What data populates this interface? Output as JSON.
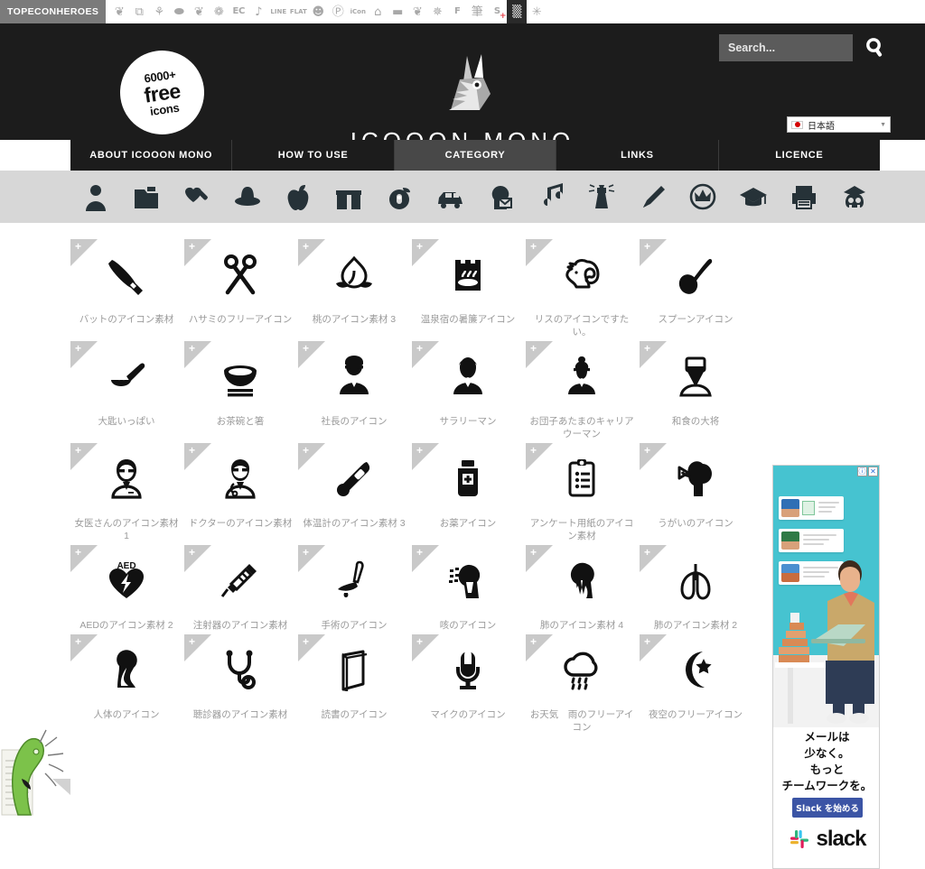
{
  "topbar": {
    "brand": "TOPECONHEROES",
    "icons": [
      {
        "name": "sheep-icon",
        "glyph": "❦",
        "kind": "glyph"
      },
      {
        "name": "copy-icon",
        "glyph": "⧉",
        "kind": "glyph"
      },
      {
        "name": "person-cheer-icon",
        "glyph": "⚘",
        "kind": "glyph"
      },
      {
        "name": "speech-bubble-icon",
        "glyph": "⬬",
        "kind": "glyph"
      },
      {
        "name": "leaf-icon",
        "glyph": "❦",
        "kind": "glyph"
      },
      {
        "name": "flower-icon",
        "glyph": "❁",
        "kind": "glyph"
      },
      {
        "name": "ec-icon",
        "glyph": "EC",
        "kind": "label"
      },
      {
        "name": "music-note-icon",
        "glyph": "♪",
        "kind": "glyph"
      },
      {
        "name": "line-icon",
        "glyph": "LINE",
        "kind": "two"
      },
      {
        "name": "flat-icon",
        "glyph": "FL|AT",
        "kind": "two"
      },
      {
        "name": "smiley-icon",
        "glyph": "☻",
        "kind": "glyph"
      },
      {
        "name": "parking-icon",
        "glyph": "Ⓟ",
        "kind": "glyph"
      },
      {
        "name": "icon-on-icon",
        "glyph": "iC|on",
        "kind": "two"
      },
      {
        "name": "building-icon",
        "glyph": "⌂",
        "kind": "glyph"
      },
      {
        "name": "sofa-icon",
        "glyph": "▬",
        "kind": "glyph"
      },
      {
        "name": "bird-icon",
        "glyph": "❦",
        "kind": "glyph"
      },
      {
        "name": "gear-flower-icon",
        "glyph": "✵",
        "kind": "glyph"
      },
      {
        "name": "f-icon",
        "glyph": "F",
        "kind": "label"
      },
      {
        "name": "brush-icon",
        "glyph": "筆",
        "kind": "glyph"
      },
      {
        "name": "s-plus-icon",
        "glyph": "S",
        "kind": "redplus"
      },
      {
        "name": "grid-icon",
        "glyph": "▒",
        "kind": "dark"
      },
      {
        "name": "sparkle-icon",
        "glyph": "✳",
        "kind": "glyph"
      }
    ]
  },
  "header": {
    "badge_line1": "6000+",
    "badge_line2": "free",
    "badge_line3": "icons",
    "logo_title": "ICOOON MONO",
    "search_placeholder": "Search...",
    "search_value": "",
    "language": "日本語"
  },
  "nav": {
    "items": [
      {
        "label": "ABOUT ICOOON MONO",
        "active": false
      },
      {
        "label": "HOW TO USE",
        "active": false
      },
      {
        "label": "CATEGORY",
        "active": true
      },
      {
        "label": "LINKS",
        "active": false
      },
      {
        "label": "LICENCE",
        "active": false
      }
    ]
  },
  "category_bar": {
    "items": [
      {
        "name": "person-icon"
      },
      {
        "name": "folder-icon"
      },
      {
        "name": "heart-syringe-icon"
      },
      {
        "name": "hat-icon"
      },
      {
        "name": "apple-icon"
      },
      {
        "name": "gift-icon"
      },
      {
        "name": "piggy-bank-icon"
      },
      {
        "name": "car-icon"
      },
      {
        "name": "mail-head-icon"
      },
      {
        "name": "music-note-icon"
      },
      {
        "name": "lighthouse-icon"
      },
      {
        "name": "pencil-icon"
      },
      {
        "name": "crown-badge-icon"
      },
      {
        "name": "graduation-cap-icon"
      },
      {
        "name": "printer-icon"
      },
      {
        "name": "skull-icon"
      }
    ]
  },
  "grid": {
    "plus_label": "+",
    "items": [
      {
        "label": "バットのアイコン素材",
        "icon": "bat-icon"
      },
      {
        "label": "ハサミのフリーアイコン",
        "icon": "scissors-icon"
      },
      {
        "label": "桃のアイコン素材 3",
        "icon": "peach-icon"
      },
      {
        "label": "温泉宿の暑簾アイコン",
        "icon": "onsen-icon"
      },
      {
        "label": "リスのアイコンですたい。",
        "icon": "squirrel-icon"
      },
      {
        "label": "スプーンアイコン",
        "icon": "spoon-icon"
      },
      {
        "label": "大匙いっぱい",
        "icon": "ladle-icon"
      },
      {
        "label": "お茶碗と箸",
        "icon": "rice-bowl-icon"
      },
      {
        "label": "社長のアイコン",
        "icon": "president-icon"
      },
      {
        "label": "サラリーマン",
        "icon": "salaryman-icon"
      },
      {
        "label": "お団子あたまのキャリアウーマン",
        "icon": "career-woman-icon"
      },
      {
        "label": "和食の大将",
        "icon": "chef-icon"
      },
      {
        "label": "女医さんのアイコン素材 1",
        "icon": "female-doctor-icon"
      },
      {
        "label": "ドクターのアイコン素材",
        "icon": "doctor-icon"
      },
      {
        "label": "体温計のアイコン素材 3",
        "icon": "thermometer-icon"
      },
      {
        "label": "お薬アイコン",
        "icon": "medicine-icon"
      },
      {
        "label": "アンケート用紙のアイコン素材",
        "icon": "clipboard-icon"
      },
      {
        "label": "うがいのアイコン",
        "icon": "gargle-icon"
      },
      {
        "label": "AEDのアイコン素材 2",
        "icon": "aed-icon"
      },
      {
        "label": "注射器のアイコン素材",
        "icon": "syringe-icon"
      },
      {
        "label": "手術のアイコン",
        "icon": "surgery-icon"
      },
      {
        "label": "咳のアイコン",
        "icon": "cough-icon"
      },
      {
        "label": "肺のアイコン素材 4",
        "icon": "lung-person-icon"
      },
      {
        "label": "肺のアイコン素材 2",
        "icon": "lungs-icon"
      },
      {
        "label": "人体のアイコン",
        "icon": "human-body-icon"
      },
      {
        "label": "聴診器のアイコン素材",
        "icon": "stethoscope-icon"
      },
      {
        "label": "読書のアイコン",
        "icon": "book-icon"
      },
      {
        "label": "マイクのアイコン",
        "icon": "microphone-icon"
      },
      {
        "label": "お天気　雨のフリーアイコン",
        "icon": "rain-cloud-icon"
      },
      {
        "label": "夜空のフリーアイコン",
        "icon": "moon-star-icon"
      }
    ]
  },
  "ad": {
    "info_label": "ⓘ",
    "close_label": "✕",
    "line1": "メールは",
    "line2": "少なく。",
    "line3": "もっと",
    "line4": "チームワークを。",
    "cta": "Slack を始める",
    "brand": "slack"
  },
  "colors": {
    "header_bg": "#1c1c1c",
    "nav_active": "#484848",
    "cat_bar_bg": "#d7d7d7",
    "caption": "#9a9a9a",
    "corner": "#c9c9c9",
    "ad_teal": "#46c3d0",
    "ad_cta": "#3b54a5",
    "topbar_brand_bg": "#7b7b7b"
  }
}
